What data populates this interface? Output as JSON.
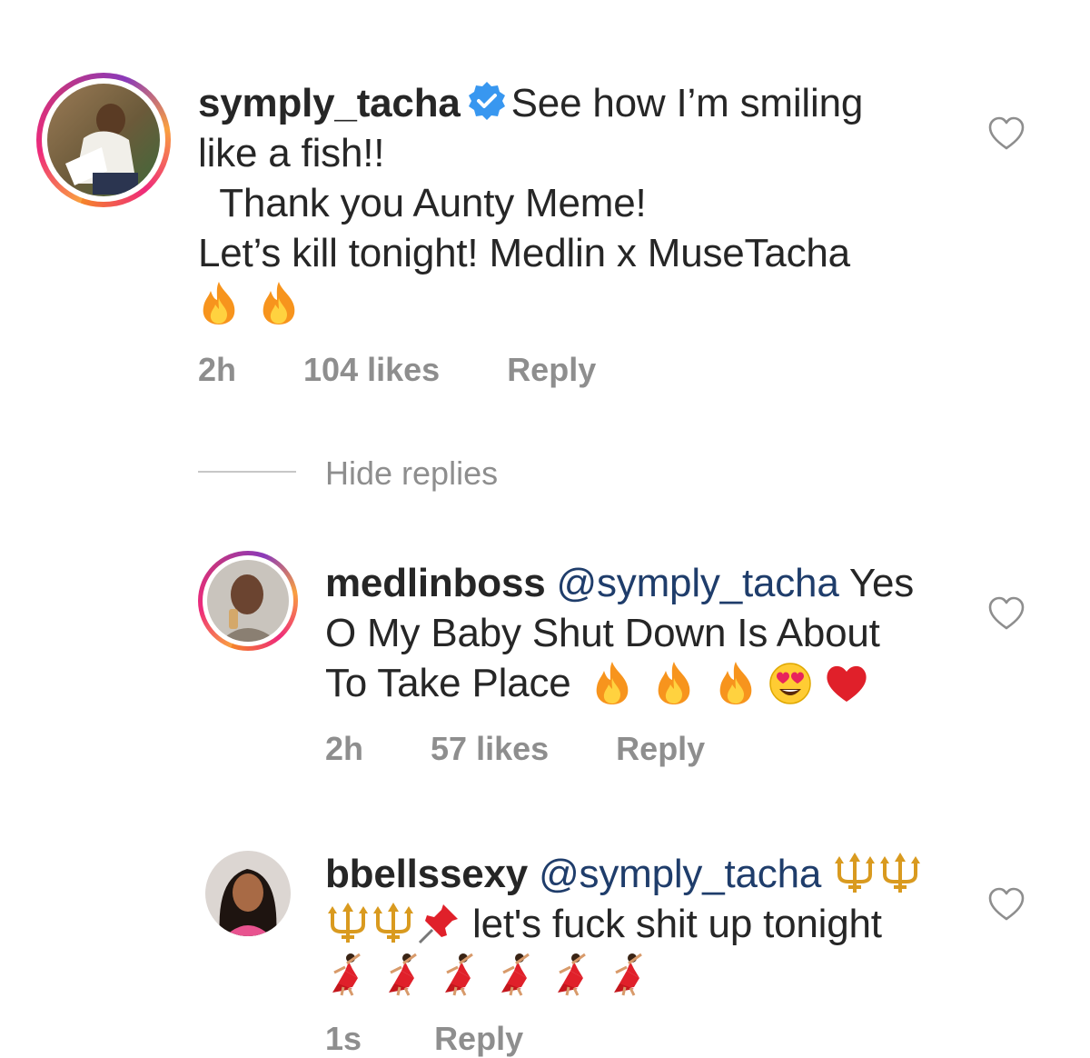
{
  "comments": [
    {
      "username": "symply_tacha",
      "text_line1": "See how I’m smiling",
      "text_line2": "like a fish!!",
      "text_line3": "  Thank you Aunty Meme!",
      "text_line4": "Let’s kill tonight! Medlin x MuseTacha",
      "emojis": [
        "fire",
        "fire"
      ],
      "time": "2h",
      "likes": "104 likes",
      "reply_label": "Reply",
      "verified": true
    },
    {
      "username": "medlinboss",
      "mention": "@symply_tacha",
      "text_line1": "Yes",
      "text_line2": "O My Baby Shut Down Is About",
      "text_line3": "To Take Place",
      "emojis": [
        "fire",
        "fire",
        "fire",
        "heart-eyes",
        "red-heart"
      ],
      "time": "2h",
      "likes": "57 likes",
      "reply_label": "Reply"
    },
    {
      "username": "bbellssexy",
      "mention": "@symply_tacha",
      "text_line2": "let's fuck shit up tonight",
      "emojis_line1": [
        "trident",
        "trident"
      ],
      "emojis_line2": [
        "trident",
        "trident",
        "pushpin"
      ],
      "emojis_line3": [
        "dancer",
        "dancer",
        "dancer",
        "dancer",
        "dancer",
        "dancer"
      ],
      "time": "1s",
      "reply_label": "Reply"
    }
  ],
  "thread": {
    "hide_replies_label": "Hide replies"
  },
  "icons": {
    "like": "heart-outline-icon",
    "verified": "verified-badge-icon"
  },
  "colors": {
    "text": "#262626",
    "meta": "#8e8e8e",
    "mention": "#1f3d6b",
    "verified": "#3897f0"
  }
}
